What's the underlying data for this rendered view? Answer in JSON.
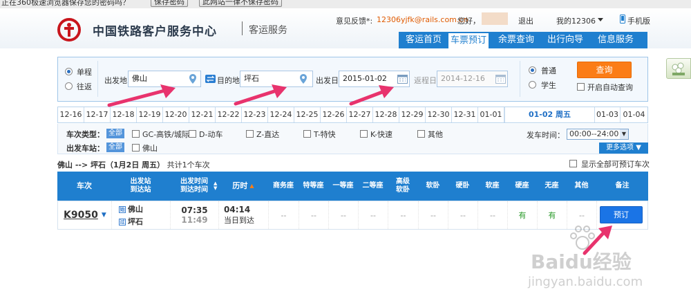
{
  "browser_strip": {
    "notice": "正在360极速浏览器保存您的密码吗？",
    "save_btn": "保存密码",
    "never_btn": "此网站一律不保存密码"
  },
  "header": {
    "brand": "中国铁路客户服务中心",
    "sub": "客运服务",
    "feedback_label": "意见反馈*:",
    "feedback_email": "12306yjfk@rails.com.cn",
    "greeting": "您好，",
    "logout": "退出",
    "my12306": "我的12306",
    "mobile": "手机版",
    "nav": [
      "客运首页",
      "车票预订",
      "余票查询",
      "出行向导",
      "信息服务"
    ],
    "nav_active_index": 1
  },
  "search": {
    "trip_types": [
      "单程",
      "往返"
    ],
    "trip_selected": "单程",
    "from_label": "出发地",
    "from_value": "佛山",
    "to_label": "目的地",
    "to_value": "坪石",
    "depart_label": "出发日",
    "depart_value": "2015-01-02",
    "return_label": "返程日",
    "return_value": "2014-12-16",
    "passenger_types": [
      "普通",
      "学生"
    ],
    "passenger_selected": "普通",
    "query_button": "查询",
    "auto_query_label": "开启自动查询"
  },
  "date_tabs": [
    "12-16",
    "12-17",
    "12-18",
    "12-19",
    "12-20",
    "12-21",
    "12-22",
    "12-23",
    "12-24",
    "12-25",
    "12-26",
    "12-27",
    "12-28",
    "12-29",
    "12-30",
    "12-31",
    "01-01",
    "01-02 周五",
    "01-03",
    "01-04"
  ],
  "date_active": "01-02 周五",
  "filters": {
    "train_type_label": "车次类型：",
    "all_tag": "全部",
    "train_types": [
      "GC-高铁/城际",
      "D-动车",
      "Z-直达",
      "T-特快",
      "K-快速",
      "其他"
    ],
    "station_label": "出发车站：",
    "stations": [
      "佛山"
    ],
    "depart_time_label": "发车时间：",
    "depart_time_value": "00:00--24:00",
    "more_options": "更多选项"
  },
  "summary": {
    "route": "佛山 --> 坪石（1月2日  周五）",
    "count_text": "共计1个车次",
    "show_all_label": "显示全部可预订车次"
  },
  "table": {
    "headers": [
      "车次",
      "出发站\n到达站",
      "出发时间\n到达时间",
      "历时",
      "商务座",
      "特等座",
      "一等座",
      "二等座",
      "高级\n软卧",
      "软卧",
      "硬卧",
      "软座",
      "硬座",
      "无座",
      "其他",
      "备注"
    ],
    "row": {
      "train_no": "K9050",
      "from_icon": "始",
      "from_station": "佛山",
      "to_icon": "过",
      "to_station": "坪石",
      "depart_time": "07:35",
      "arrive_time": "11:49",
      "duration": "04:14",
      "arrive_day": "当日到达",
      "seats": [
        "--",
        "--",
        "--",
        "--",
        "--",
        "--",
        "--",
        "--",
        "有",
        "有",
        "--"
      ],
      "book_button": "预订"
    }
  },
  "watermark": {
    "brand": "Baidu经验",
    "url": "jingyan.baidu.com"
  },
  "colors": {
    "brand_blue": "#1f7fcf",
    "accent_orange": "#fb7d16",
    "arrow_pink": "#e8336d",
    "available_green": "#2a9a2a"
  }
}
